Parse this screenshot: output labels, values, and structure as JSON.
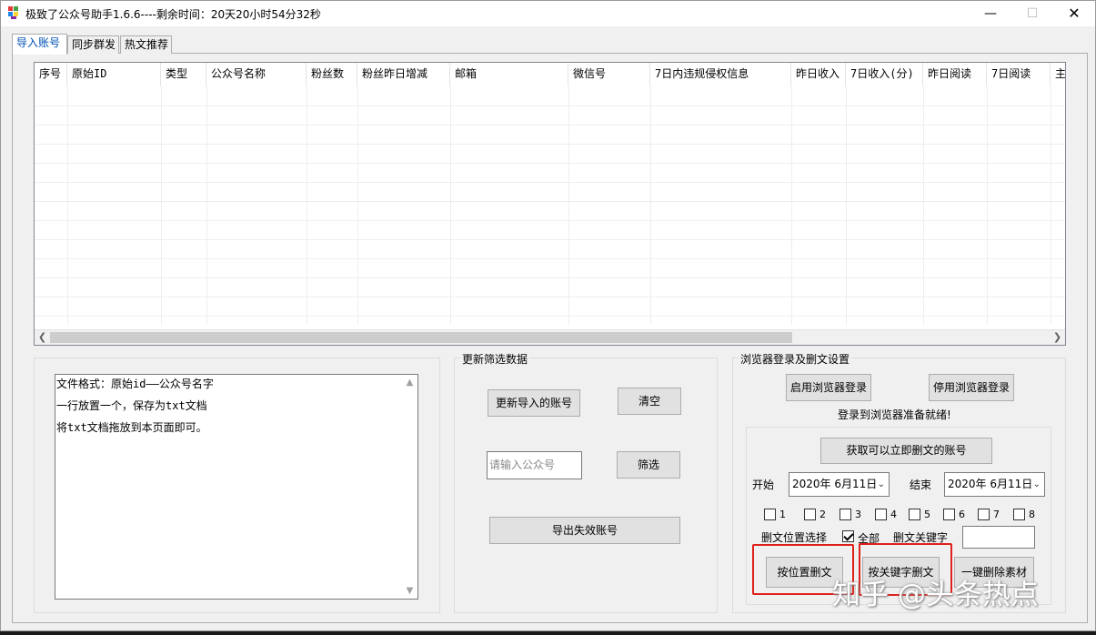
{
  "window": {
    "title": "极致了公众号助手1.6.6----剩余时间：20天20小时54分32秒",
    "minimize": "—",
    "maximize": "☐",
    "close": "✕"
  },
  "tabs": [
    {
      "label": "导入账号",
      "active": true
    },
    {
      "label": "同步群发",
      "active": false
    },
    {
      "label": "热文推荐",
      "active": false
    }
  ],
  "grid": {
    "columns": [
      "序号",
      "原始ID",
      "类型",
      "公众号名称",
      "粉丝数",
      "粉丝昨日增减",
      "邮箱",
      "微信号",
      "7日内违规侵权信息",
      "昨日收入",
      "7日收入(分)",
      "昨日阅读",
      "7日阅读",
      "主"
    ],
    "rows": []
  },
  "import_notes": {
    "lines": [
      "文件格式：原始id——公众号名字",
      "一行放置一个，保存为txt文档",
      "将txt文档拖放到本页面即可。"
    ]
  },
  "filter_group": {
    "title": "更新筛选数据",
    "update_button": "更新导入的账号",
    "clear_button": "清空",
    "search_placeholder": "请输入公众号",
    "filter_button": "筛选",
    "export_button": "导出失效账号"
  },
  "browser_group": {
    "title": "浏览器登录及删文设置",
    "enable_login": "启用浏览器登录",
    "disable_login": "停用浏览器登录",
    "status": "登录到浏览器准备就绪!",
    "get_accounts": "获取可以立即删文的账号",
    "start_label": "开始",
    "start_date": "2020年 6月11日",
    "end_label": "结束",
    "end_date": "2020年 6月11日",
    "positions": [
      "1",
      "2",
      "3",
      "4",
      "5",
      "6",
      "7",
      "8"
    ],
    "position_select_label": "删文位置选择",
    "all_label": "全部",
    "keyword_label": "删文关键字",
    "keyword_value": "",
    "delete_by_position": "按位置删文",
    "delete_by_keyword": "按关键字删文",
    "delete_all_material": "一键删除素材"
  },
  "watermark": "知乎 @头条热点",
  "colors": {
    "tab_active_text": "#0050b4",
    "highlight_box": "#e0211b"
  }
}
